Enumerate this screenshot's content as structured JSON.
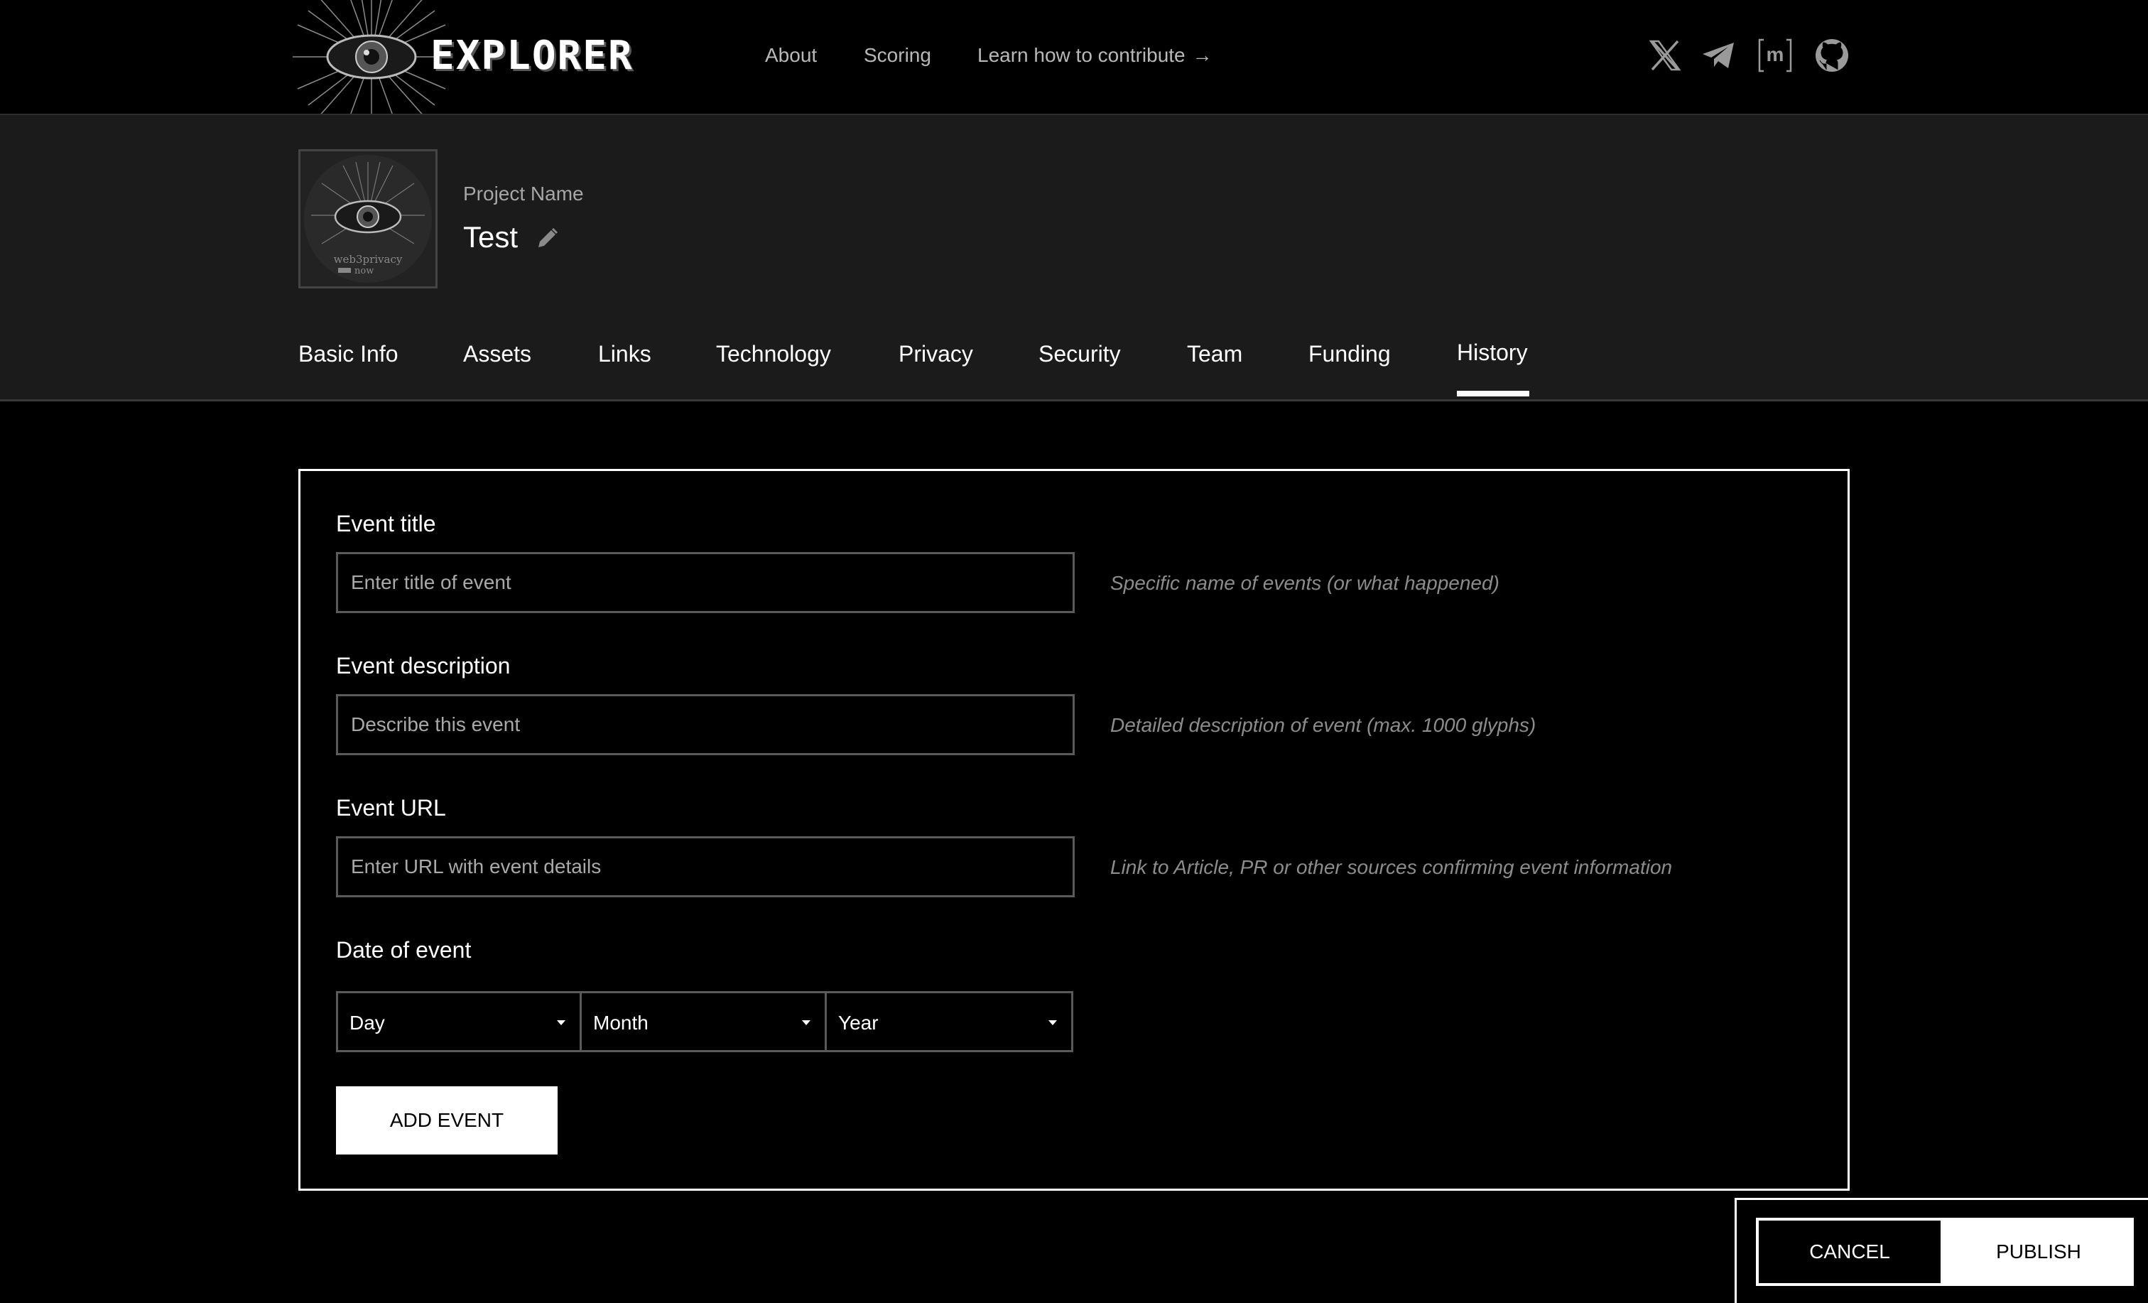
{
  "brand": {
    "logo_text": "EXPLORER",
    "logo_icon": "eye-icon"
  },
  "nav": {
    "about": "About",
    "scoring": "Scoring",
    "contribute": "Learn how to contribute",
    "contribute_arrow": "→"
  },
  "social": {
    "icons": [
      "x-twitter-icon",
      "telegram-icon",
      "matrix-icon",
      "github-icon"
    ],
    "matrix_text": "[m]"
  },
  "project": {
    "label": "Project Name",
    "name": "Test",
    "avatar_line1": "web3privacy",
    "avatar_line2": "now"
  },
  "tabs": [
    {
      "label": "Basic Info"
    },
    {
      "label": "Assets"
    },
    {
      "label": "Links"
    },
    {
      "label": "Technology"
    },
    {
      "label": "Privacy"
    },
    {
      "label": "Security"
    },
    {
      "label": "Team"
    },
    {
      "label": "Funding"
    },
    {
      "label": "History",
      "active": true
    }
  ],
  "form": {
    "title": {
      "label": "Event title",
      "placeholder": "Enter title of event",
      "hint": "Specific name of events (or what happened)"
    },
    "description": {
      "label": "Event description",
      "placeholder": "Describe this event",
      "hint": "Detailed description of event (max. 1000 glyphs)"
    },
    "url": {
      "label": "Event URL",
      "placeholder": "Enter URL with event details",
      "hint": "Link to Article, PR or other sources confirming event information"
    },
    "date": {
      "label": "Date of event",
      "day": "Day",
      "month": "Month",
      "year": "Year"
    },
    "add_button": "ADD EVENT"
  },
  "actions": {
    "cancel": "CANCEL",
    "publish": "PUBLISH"
  },
  "colors": {
    "background": "#000000",
    "band": "#1b1b1b",
    "text": "#ffffff",
    "muted": "#8c8c8c"
  }
}
